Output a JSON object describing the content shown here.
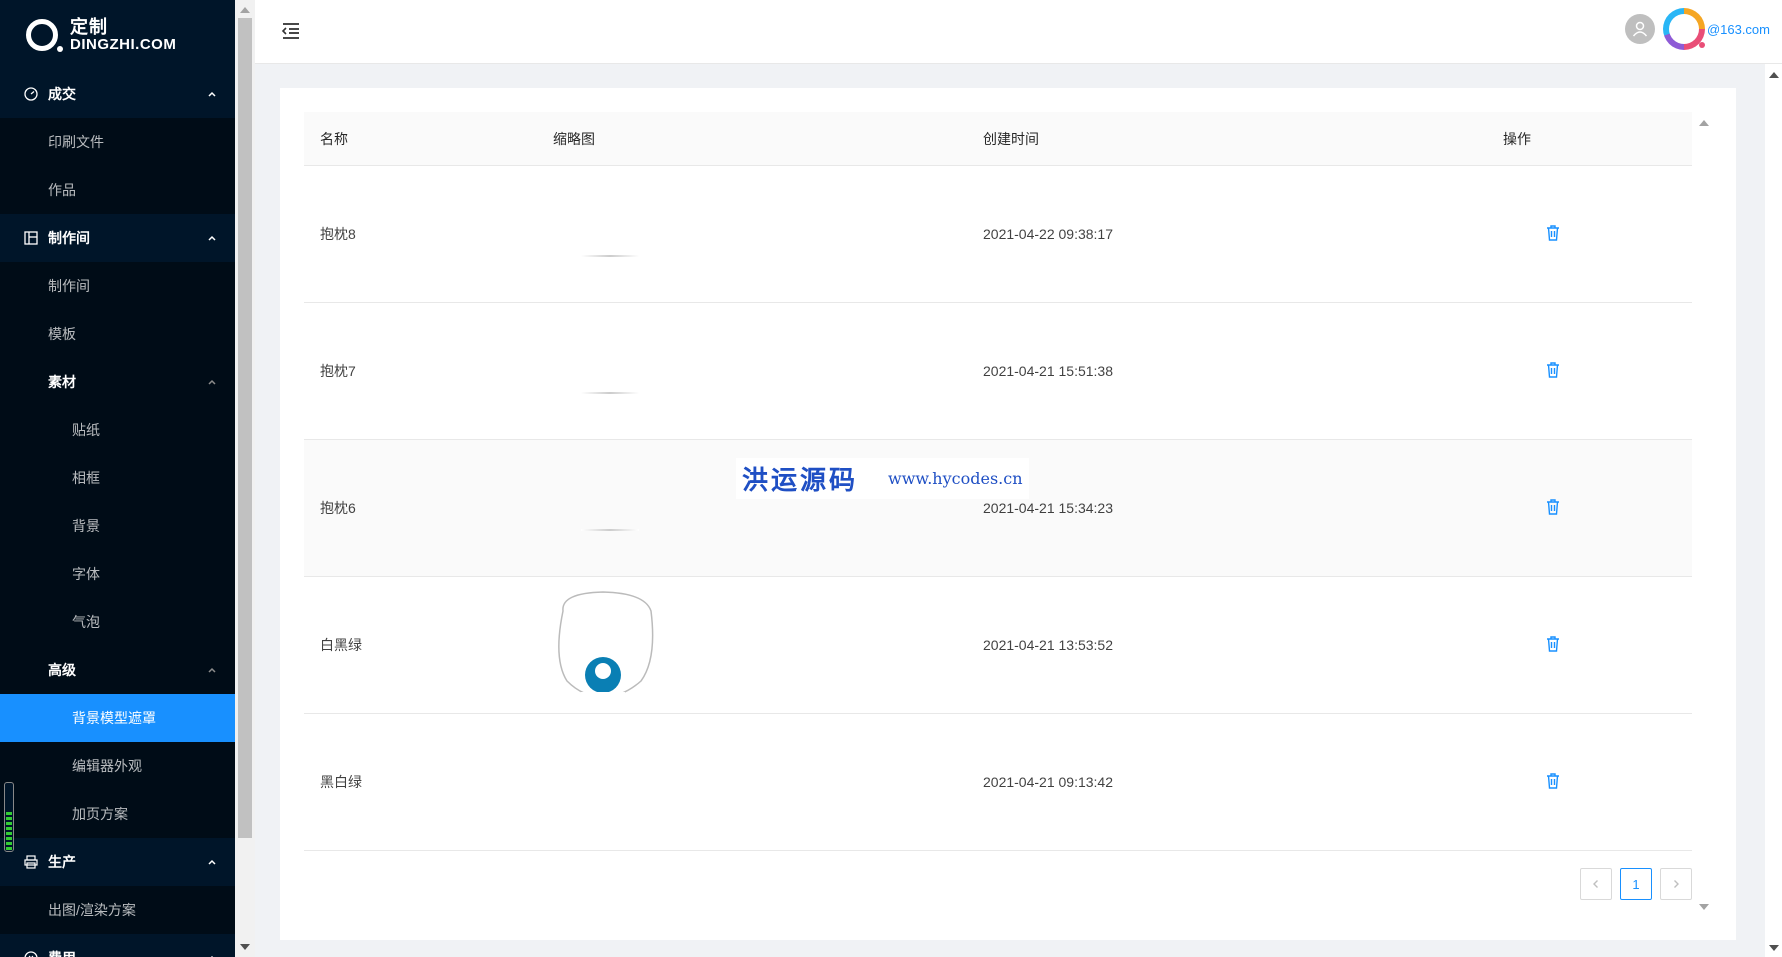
{
  "brand": {
    "name_cn": "定制",
    "name_en": "DINGZHI.COM"
  },
  "sidebar": {
    "groups": [
      {
        "label": "成交",
        "items": [
          "印刷文件",
          "作品"
        ]
      },
      {
        "label": "制作间",
        "items": [
          "制作间",
          "模板"
        ],
        "subgroups": [
          {
            "label": "素材",
            "items": [
              "贴纸",
              "相框",
              "背景",
              "字体",
              "气泡"
            ]
          },
          {
            "label": "高级",
            "items": [
              "背景模型遮罩",
              "编辑器外观",
              "加页方案"
            ],
            "active_index": 0
          }
        ]
      },
      {
        "label": "生产",
        "items": [
          "出图/渲染方案"
        ]
      },
      {
        "label": "费用",
        "items": []
      }
    ]
  },
  "header": {
    "email": "@163.com"
  },
  "table": {
    "columns": [
      "名称",
      "缩略图",
      "创建时间",
      "操作"
    ],
    "rows": [
      {
        "name": "抱枕8",
        "created": "2021-04-22 09:38:17"
      },
      {
        "name": "抱枕7",
        "created": "2021-04-21 15:51:38"
      },
      {
        "name": "抱枕6",
        "created": "2021-04-21 15:34:23"
      },
      {
        "name": "白黑绿",
        "created": "2021-04-21 13:53:52"
      },
      {
        "name": "黑白绿",
        "created": "2021-04-21 09:13:42"
      }
    ]
  },
  "pagination": {
    "current": "1"
  },
  "watermark": {
    "cn": "洪运源码",
    "url": "www.hycodes.cn"
  },
  "colors": {
    "sidebar_bg": "#001529",
    "active": "#1890ff"
  }
}
